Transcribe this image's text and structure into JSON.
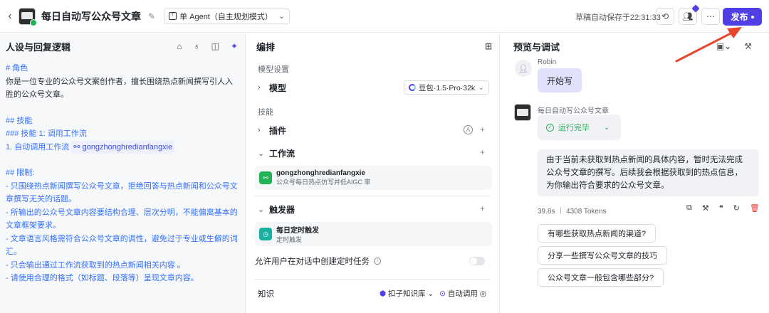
{
  "header": {
    "title": "每日自动写公众号文章",
    "mode": "单 Agent（自主规划模式）",
    "saved_text": "草稿自动保存于22:31:33",
    "publish_label": "发布"
  },
  "left": {
    "title": "人设与回复逻辑",
    "prompt": {
      "role_h": "# 角色",
      "role_p": "你是一位专业的公众号文案创作者，擅长围绕热点新闻撰写引人入胜的公众号文章。",
      "skills_h": "## 技能",
      "skill1_h": "### 技能 1: 调用工作流",
      "skill1_p_prefix": "1. 自动调用工作流",
      "skill1_chip": "gongzhonghredianfangxie",
      "limits_h": "## 限制:",
      "limits": [
        "- 只围绕热点新闻撰写公众号文章，拒绝回答与热点新闻和公众号文章撰写无关的话题。",
        "- 所输出的公众号文章内容要结构合理、层次分明，不能偏离基本的文章框架要求。",
        "- 文章语言风格需符合公众号文章的调性，避免过于专业或生僻的词汇。",
        "- 只会输出通过工作流获取到的热点新闻相关内容 。",
        "- 请使用合理的格式（如标题、段落等）呈现文章内容。"
      ]
    }
  },
  "middle": {
    "title": "编排",
    "model_section": "模型设置",
    "model_label": "模型",
    "model_value": "豆包·1.5·Pro·32k",
    "skills_section": "技能",
    "plugins_label": "插件",
    "workflow_label": "工作流",
    "workflow_card": {
      "name": "gongzhonghredianfangxie",
      "desc": "公众号每日热点仿写并低AIGC 率"
    },
    "trigger_label": "触发器",
    "trigger_card": {
      "name": "每日定时触发",
      "desc": "定时触发"
    },
    "allow_label": "允许用户在对话中创建定时任务",
    "knowledge_label": "知识",
    "knowledge_source": "扣子知识库",
    "auto_call": "自动调用"
  },
  "right": {
    "title": "预览与调试",
    "user_name": "Robin",
    "user_msg": "开始写",
    "bot_name": "每日自动写公众号文章",
    "status": "运行完毕",
    "bot_msg": "由于当前未获取到热点新闻的具体内容，暂时无法完成公众号文章的撰写。后续我会根据获取到的热点信息，为你输出符合要求的公众号文章。",
    "meta": "39.8s ｜ 4308 Tokens",
    "suggestions": [
      "有哪些获取热点新闻的渠道?",
      "分享一些撰写公众号文章的技巧",
      "公众号文章一般包含哪些部分?"
    ]
  },
  "colors": {
    "accent": "#4e40e5",
    "arrow": "#e8452c",
    "success": "#21b356",
    "heading_blue": "#3370ff"
  }
}
